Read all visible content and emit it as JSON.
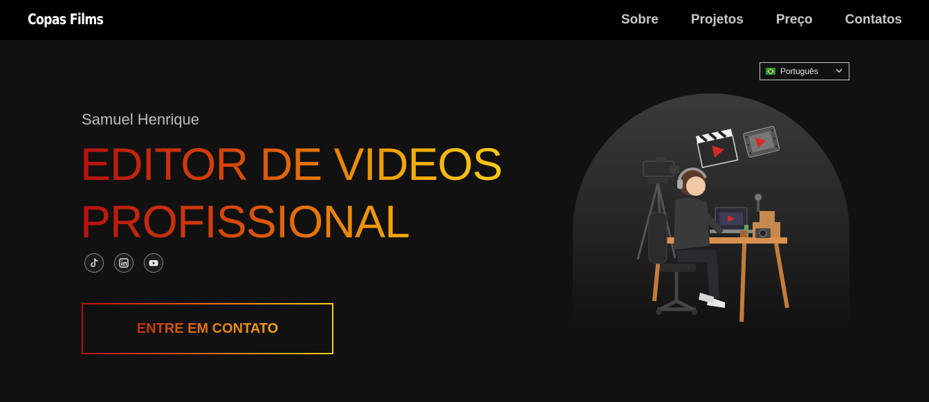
{
  "header": {
    "logo": "Copas Films",
    "nav": [
      "Sobre",
      "Projetos",
      "Preço",
      "Contatos"
    ]
  },
  "language": {
    "selected": "Português",
    "flag_icon": "brazil-flag-icon"
  },
  "hero": {
    "subtitle": "Samuel Henrique",
    "headline_line1": "EDITOR DE VIDEOS",
    "headline_line2": "PROFISSIONAL",
    "socials": [
      "tiktok-icon",
      "linkedin-icon",
      "youtube-icon"
    ],
    "cta": "ENTRE EM CONTATO",
    "illustration": "video-editor-illustration"
  },
  "colors": {
    "background": "#111111",
    "topbar": "#000000",
    "gradient_start": "#b81010",
    "gradient_end": "#ffd21a"
  }
}
